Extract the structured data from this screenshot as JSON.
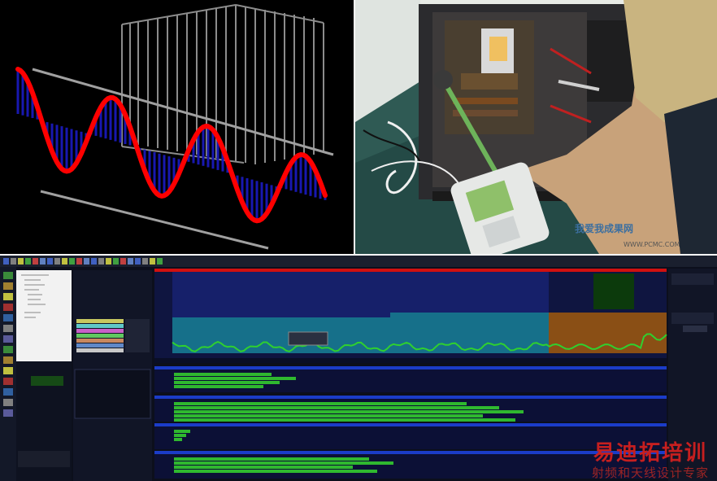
{
  "watermark": {
    "photo_brand": "我爱我成果网",
    "photo_url": "WWW.PCMC.COM",
    "corner_title": "易迪拓培训",
    "corner_subtitle": "射频和天线设计专家"
  },
  "colors": {
    "wave": "#ff0000",
    "wave_fill": "#1010a0",
    "analyzer_bg": "#0c0f1c",
    "trace_green": "#2fd02f",
    "panel_blue": "#1b3cc8",
    "accent_red": "#d01010"
  },
  "icons": {
    "meter": "handheld-field-meter",
    "probe": "e-field-probe"
  }
}
